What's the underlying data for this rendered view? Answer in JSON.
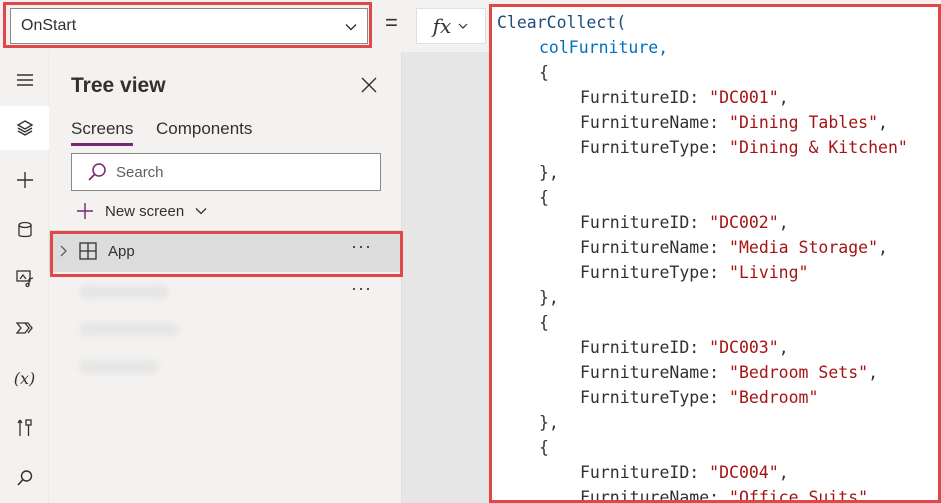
{
  "formula_bar": {
    "property": "OnStart",
    "equals": "=",
    "fx_label": "fx"
  },
  "rail": {
    "icons": [
      "hamburger-icon",
      "layers-icon",
      "plus-icon",
      "database-icon",
      "media-icon",
      "power-automate-icon",
      "variables-icon",
      "tools-icon",
      "search-icon"
    ],
    "variables_text": "(x)"
  },
  "tree_view": {
    "title": "Tree view",
    "tabs": [
      {
        "label": "Screens",
        "active": true
      },
      {
        "label": "Components",
        "active": false
      }
    ],
    "search_placeholder": "Search",
    "new_screen": "New screen",
    "app_item": "App",
    "more": "···"
  },
  "code": {
    "lines": [
      {
        "indent": 0,
        "parts": [
          {
            "t": "ClearCollect(",
            "c": "fn"
          }
        ]
      },
      {
        "indent": 1,
        "parts": [
          {
            "t": "colFurniture,",
            "c": "id"
          }
        ]
      },
      {
        "indent": 1,
        "parts": [
          {
            "t": "{",
            "c": "plain"
          }
        ]
      },
      {
        "indent": 2,
        "parts": [
          {
            "t": "FurnitureID: ",
            "c": "plain"
          },
          {
            "t": "\"DC001\"",
            "c": "str"
          },
          {
            "t": ",",
            "c": "plain"
          }
        ]
      },
      {
        "indent": 2,
        "parts": [
          {
            "t": "FurnitureName: ",
            "c": "plain"
          },
          {
            "t": "\"Dining Tables\"",
            "c": "str"
          },
          {
            "t": ",",
            "c": "plain"
          }
        ]
      },
      {
        "indent": 2,
        "parts": [
          {
            "t": "FurnitureType: ",
            "c": "plain"
          },
          {
            "t": "\"Dining & Kitchen\"",
            "c": "str"
          }
        ]
      },
      {
        "indent": 1,
        "parts": [
          {
            "t": "},",
            "c": "plain"
          }
        ]
      },
      {
        "indent": 1,
        "parts": [
          {
            "t": "{",
            "c": "plain"
          }
        ]
      },
      {
        "indent": 2,
        "parts": [
          {
            "t": "FurnitureID: ",
            "c": "plain"
          },
          {
            "t": "\"DC002\"",
            "c": "str"
          },
          {
            "t": ",",
            "c": "plain"
          }
        ]
      },
      {
        "indent": 2,
        "parts": [
          {
            "t": "FurnitureName: ",
            "c": "plain"
          },
          {
            "t": "\"Media Storage\"",
            "c": "str"
          },
          {
            "t": ",",
            "c": "plain"
          }
        ]
      },
      {
        "indent": 2,
        "parts": [
          {
            "t": "FurnitureType: ",
            "c": "plain"
          },
          {
            "t": "\"Living\"",
            "c": "str"
          }
        ]
      },
      {
        "indent": 1,
        "parts": [
          {
            "t": "},",
            "c": "plain"
          }
        ]
      },
      {
        "indent": 1,
        "parts": [
          {
            "t": "{",
            "c": "plain"
          }
        ]
      },
      {
        "indent": 2,
        "parts": [
          {
            "t": "FurnitureID: ",
            "c": "plain"
          },
          {
            "t": "\"DC003\"",
            "c": "str"
          },
          {
            "t": ",",
            "c": "plain"
          }
        ]
      },
      {
        "indent": 2,
        "parts": [
          {
            "t": "FurnitureName: ",
            "c": "plain"
          },
          {
            "t": "\"Bedroom Sets\"",
            "c": "str"
          },
          {
            "t": ",",
            "c": "plain"
          }
        ]
      },
      {
        "indent": 2,
        "parts": [
          {
            "t": "FurnitureType: ",
            "c": "plain"
          },
          {
            "t": "\"Bedroom\"",
            "c": "str"
          }
        ]
      },
      {
        "indent": 1,
        "parts": [
          {
            "t": "},",
            "c": "plain"
          }
        ]
      },
      {
        "indent": 1,
        "parts": [
          {
            "t": "{",
            "c": "plain"
          }
        ]
      },
      {
        "indent": 2,
        "parts": [
          {
            "t": "FurnitureID: ",
            "c": "plain"
          },
          {
            "t": "\"DC004\"",
            "c": "str"
          },
          {
            "t": ",",
            "c": "plain"
          }
        ]
      },
      {
        "indent": 2,
        "parts": [
          {
            "t": "FurnitureName: ",
            "c": "plain"
          },
          {
            "t": "\"Office Suits\"",
            "c": "str"
          },
          {
            "t": ",",
            "c": "plain"
          }
        ]
      }
    ]
  },
  "colors": {
    "highlight": "#e04848",
    "accent": "#742774",
    "string": "#a31515",
    "function": "#1f4e79",
    "identifier": "#0070c1"
  }
}
